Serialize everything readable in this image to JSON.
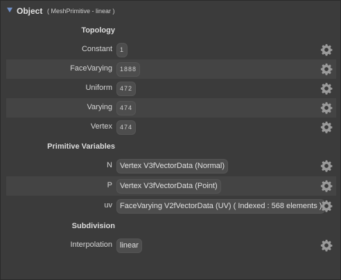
{
  "header": {
    "title": "Object",
    "subtitle": "( MeshPrimitive - linear )"
  },
  "sections": {
    "topology": "Topology",
    "primvars": "Primitive Variables",
    "subdivision": "Subdivision"
  },
  "topology": [
    {
      "label": "Constant",
      "value": "1"
    },
    {
      "label": "FaceVarying",
      "value": "1888"
    },
    {
      "label": "Uniform",
      "value": "472"
    },
    {
      "label": "Varying",
      "value": "474"
    },
    {
      "label": "Vertex",
      "value": "474"
    }
  ],
  "primvars": [
    {
      "label": "N",
      "value": "Vertex V3fVectorData (Normal)"
    },
    {
      "label": "P",
      "value": "Vertex V3fVectorData (Point)"
    },
    {
      "label": "uv",
      "value": "FaceVarying V2fVectorData (UV) ( Indexed : 568 elements )"
    }
  ],
  "subdivision": [
    {
      "label": "Interpolation",
      "value": "linear"
    }
  ],
  "icons": {
    "expand": "triangle-down-icon",
    "settings": "gear-icon"
  },
  "colors": {
    "accent": "#6f8fc8",
    "background": "#3b3b3b",
    "row_alt": "#444444"
  }
}
